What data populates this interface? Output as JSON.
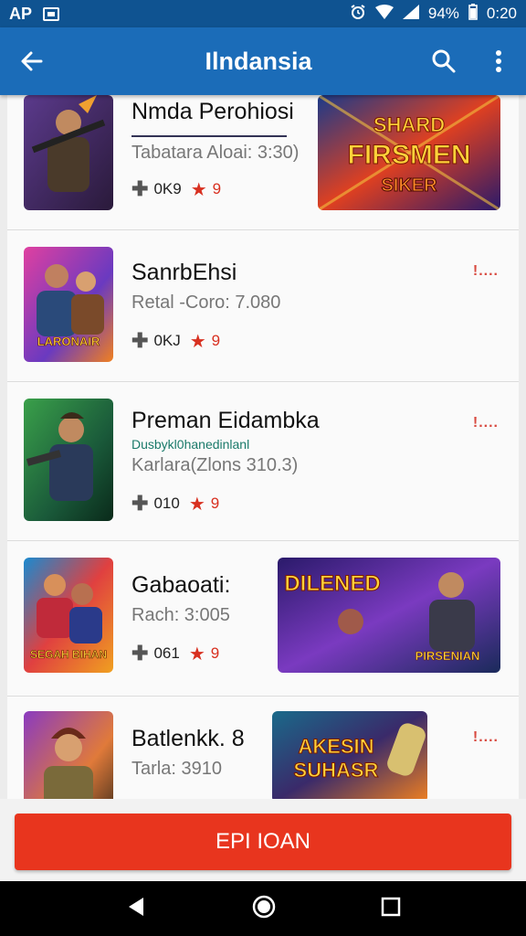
{
  "status_bar": {
    "left_text": "AP",
    "battery": "94%",
    "time": "0:20"
  },
  "app_bar": {
    "title": "Ilndansia",
    "back_icon": "arrow-back-icon",
    "search_icon": "search-icon",
    "menu_icon": "more-vert-icon"
  },
  "colors": {
    "status_bar": "#0f5391",
    "app_bar": "#1b6cb8",
    "cta": "#e8351e",
    "rating": "#d83020"
  },
  "items": [
    {
      "name": "Nmda Perohiosi",
      "meta": "Tabatara Aloai: 3:30)",
      "downloads": "0K9",
      "rating": "9",
      "banner_text": [
        "SHARD",
        "FIRSMEN",
        "SIKER"
      ]
    },
    {
      "name": "SanrbEhsi",
      "meta": "Retal -Coro: 7.080",
      "downloads": "0KJ",
      "rating": "9",
      "badge": "!....",
      "thumb_text": "LARONAIR"
    },
    {
      "name": "Preman Eidambka",
      "sub": "Dusbykl0hanedinlanl",
      "meta": "Karlara(Zlons 310.3)",
      "downloads": "010",
      "rating": "9",
      "badge": "!...."
    },
    {
      "name": "Gabaoati:",
      "meta": "Rach: 3:005",
      "downloads": "061",
      "rating": "9",
      "thumb_text": "SEGAH BIHAN",
      "banner_text": [
        "DILENED",
        "PIRSENIAN"
      ]
    },
    {
      "name": "Batlenkk. 8",
      "meta": "Tarla: 3910",
      "badge": "!....",
      "banner_text": [
        "AKESIN",
        "SUHASR"
      ]
    }
  ],
  "cta_label": "EPI IOAN"
}
